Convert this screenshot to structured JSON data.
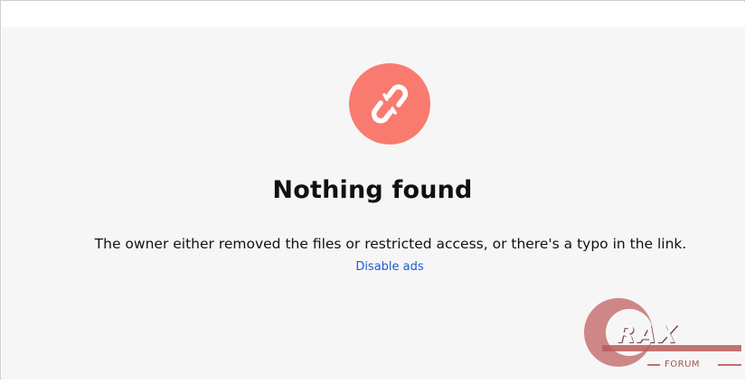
{
  "main": {
    "title": "Nothing found",
    "message": "The owner either removed the files or restricted access, or there's a typo in the link.",
    "disable_ads_link": "Disable ads",
    "error_icon": "broken-link-icon"
  },
  "watermark": {
    "brand": "RAX",
    "sublabel": "FORUM"
  },
  "colors": {
    "icon_background": "#f97b6f",
    "link": "#1b5bd6",
    "page_background": "#f6f6f6"
  }
}
